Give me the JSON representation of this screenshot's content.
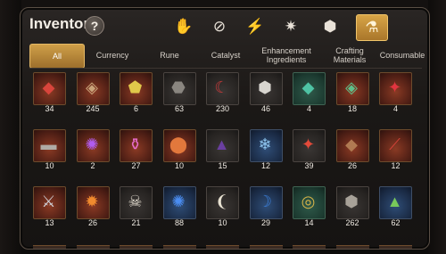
{
  "title": "Inventory",
  "help_label": "?",
  "category_icons": [
    {
      "name": "hand-item-icon",
      "glyph": "✋"
    },
    {
      "name": "no-item-icon",
      "glyph": "⊘"
    },
    {
      "name": "lightning-icon",
      "glyph": "⚡"
    },
    {
      "name": "crest-icon",
      "glyph": "✷"
    },
    {
      "name": "cube-icon",
      "glyph": "⬢"
    },
    {
      "name": "consumable-icon",
      "glyph": "⚗"
    }
  ],
  "tabs": [
    {
      "label": "All",
      "active": true
    },
    {
      "label": "Currency",
      "active": false
    },
    {
      "label": "Rune",
      "active": false
    },
    {
      "label": "Catalyst",
      "active": false
    },
    {
      "label": "Enhancement Ingredients",
      "active": false
    },
    {
      "label": "Crafting Materials",
      "active": false
    },
    {
      "label": "Consumable",
      "active": false
    }
  ],
  "items": [
    [
      {
        "icon": "red-crystal-icon",
        "glyph": "◆",
        "color": "#d8453c",
        "count": "34",
        "bg": "red"
      },
      {
        "icon": "striped-ore-icon",
        "glyph": "◈",
        "color": "#c9a37a",
        "count": "245",
        "bg": "red"
      },
      {
        "icon": "rainbow-gem-icon",
        "glyph": "⬟",
        "color": "#e0c84a",
        "count": "6",
        "bg": "red"
      },
      {
        "icon": "dark-shard-icon",
        "glyph": "⬣",
        "color": "#8a8680",
        "count": "63",
        "bg": "gray"
      },
      {
        "icon": "bone-claw-icon",
        "glyph": "☾",
        "color": "#c73a3a",
        "count": "230",
        "bg": "gray"
      },
      {
        "icon": "silver-stone-icon",
        "glyph": "⬢",
        "color": "#d8d5cf",
        "count": "46",
        "bg": "gray"
      },
      {
        "icon": "teal-crystal-icon",
        "glyph": "◆",
        "color": "#4ec3a4",
        "count": "4",
        "bg": "green"
      },
      {
        "icon": "green-ore-icon",
        "glyph": "◈",
        "color": "#5ec08a",
        "count": "18",
        "bg": "red"
      },
      {
        "icon": "ruby-cluster-icon",
        "glyph": "✦",
        "color": "#e0353f",
        "count": "4",
        "bg": "red"
      }
    ],
    [
      {
        "icon": "black-card-icon",
        "glyph": "▬",
        "color": "#b0aca6",
        "count": "10",
        "bg": "red"
      },
      {
        "icon": "purple-flame-icon",
        "glyph": "✺",
        "color": "#b15cf0",
        "count": "2",
        "bg": "red"
      },
      {
        "icon": "pink-potion-icon",
        "glyph": "⚱",
        "color": "#e46ac8",
        "count": "27",
        "bg": "red"
      },
      {
        "icon": "fire-egg-icon",
        "glyph": "⬤",
        "color": "#e2783c",
        "count": "10",
        "bg": "red"
      },
      {
        "icon": "dark-mound-icon",
        "glyph": "▲",
        "color": "#6a3fa0",
        "count": "15",
        "bg": "gray"
      },
      {
        "icon": "frost-crest-icon",
        "glyph": "❄",
        "color": "#8fc6f0",
        "count": "12",
        "bg": "blue"
      },
      {
        "icon": "red-crystals-icon",
        "glyph": "✦",
        "color": "#e24a3a",
        "count": "39",
        "bg": "gray"
      },
      {
        "icon": "brown-rubble-icon",
        "glyph": "◆",
        "color": "#b07a52",
        "count": "26",
        "bg": "red"
      },
      {
        "icon": "red-claw-icon",
        "glyph": "⟋",
        "color": "#d8433a",
        "count": "12",
        "bg": "red"
      }
    ],
    [
      {
        "icon": "silver-claw-icon",
        "glyph": "⚔",
        "color": "#d0d4dc",
        "count": "13",
        "bg": "red"
      },
      {
        "icon": "fire-orb-icon",
        "glyph": "✹",
        "color": "#f08a2e",
        "count": "26",
        "bg": "red"
      },
      {
        "icon": "skull-bones-icon",
        "glyph": "☠",
        "color": "#e6dfd2",
        "count": "21",
        "bg": "gray"
      },
      {
        "icon": "blue-flame-icon",
        "glyph": "✺",
        "color": "#4a8cf0",
        "count": "88",
        "bg": "blue"
      },
      {
        "icon": "ivory-tusk-icon",
        "glyph": "❨",
        "color": "#e8e2d2",
        "count": "10",
        "bg": "gray"
      },
      {
        "icon": "blue-fang-icon",
        "glyph": "☽",
        "color": "#3b7ed8",
        "count": "29",
        "bg": "blue"
      },
      {
        "icon": "gold-ring-icon",
        "glyph": "◎",
        "color": "#d8b448",
        "count": "14",
        "bg": "green"
      },
      {
        "icon": "stone-cluster-icon",
        "glyph": "⬢",
        "color": "#a8a299",
        "count": "262",
        "bg": "gray"
      },
      {
        "icon": "green-pyramid-icon",
        "glyph": "▲",
        "color": "#78c85a",
        "count": "62",
        "bg": "blue"
      }
    ]
  ]
}
